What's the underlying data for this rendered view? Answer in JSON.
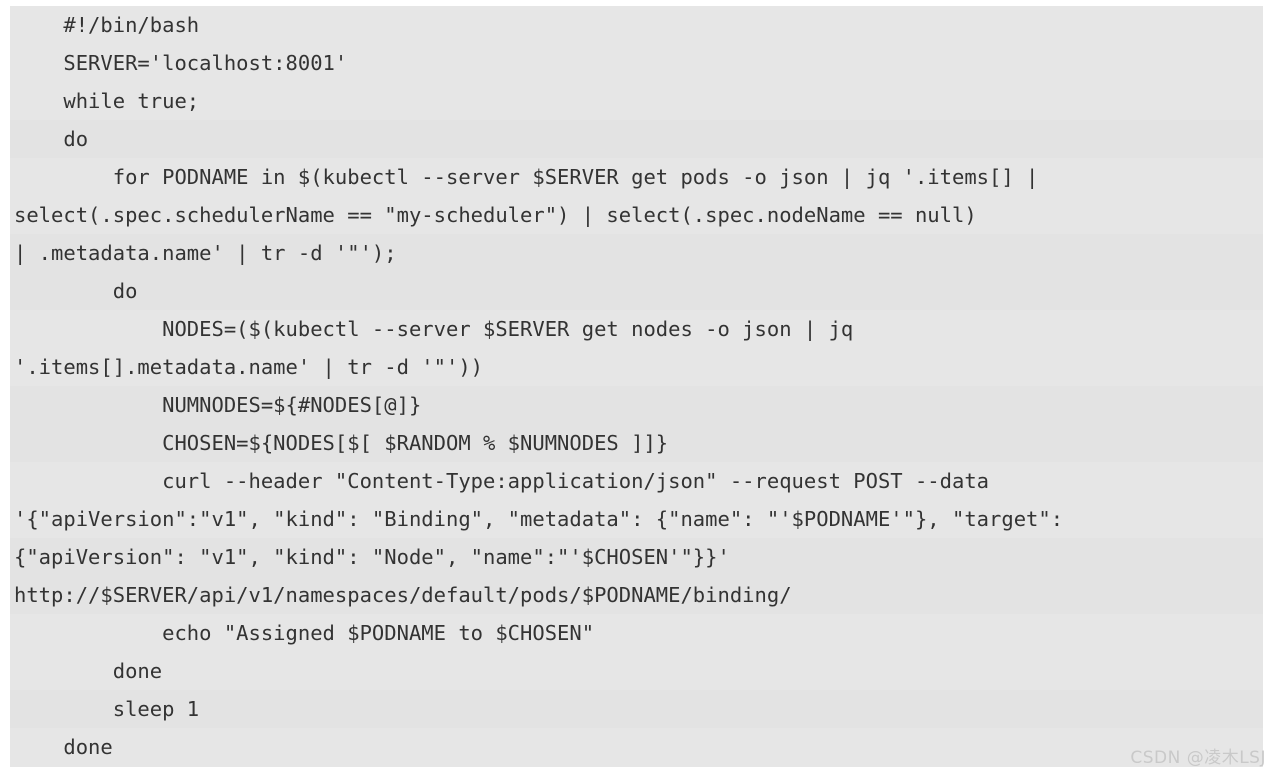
{
  "colors": {
    "page_background": "#ffffff",
    "code_background": "#e6e6e6",
    "code_band": "#e3e3e3",
    "code_text": "#333333",
    "watermark_text": "#c9c9c9"
  },
  "code_block": {
    "language": "bash",
    "lines": [
      "    #!/bin/bash",
      "    SERVER='localhost:8001'",
      "    while true;",
      "    do",
      "        for PODNAME in $(kubectl --server $SERVER get pods -o json | jq '.items[] |",
      "select(.spec.schedulerName == \"my-scheduler\") | select(.spec.nodeName == null)",
      "| .metadata.name' | tr -d '\"');",
      "        do",
      "            NODES=($(kubectl --server $SERVER get nodes -o json | jq",
      "'.items[].metadata.name' | tr -d '\"'))",
      "            NUMNODES=${#NODES[@]}",
      "            CHOSEN=${NODES[$[ $RANDOM % $NUMNODES ]]}",
      "            curl --header \"Content-Type:application/json\" --request POST --data",
      "'{\"apiVersion\":\"v1\", \"kind\": \"Binding\", \"metadata\": {\"name\": \"'$PODNAME'\"}, \"target\":",
      "{\"apiVersion\": \"v1\", \"kind\": \"Node\", \"name\":\"'$CHOSEN'\"}}'",
      "http://$SERVER/api/v1/namespaces/default/pods/$PODNAME/binding/",
      "            echo \"Assigned $PODNAME to $CHOSEN\"",
      "        done",
      "        sleep 1",
      "    done"
    ],
    "banded_line_indices": [
      3,
      6,
      7,
      10,
      11,
      14,
      15,
      18
    ]
  },
  "watermark": {
    "label": "CSDN @凌木LSJ"
  }
}
